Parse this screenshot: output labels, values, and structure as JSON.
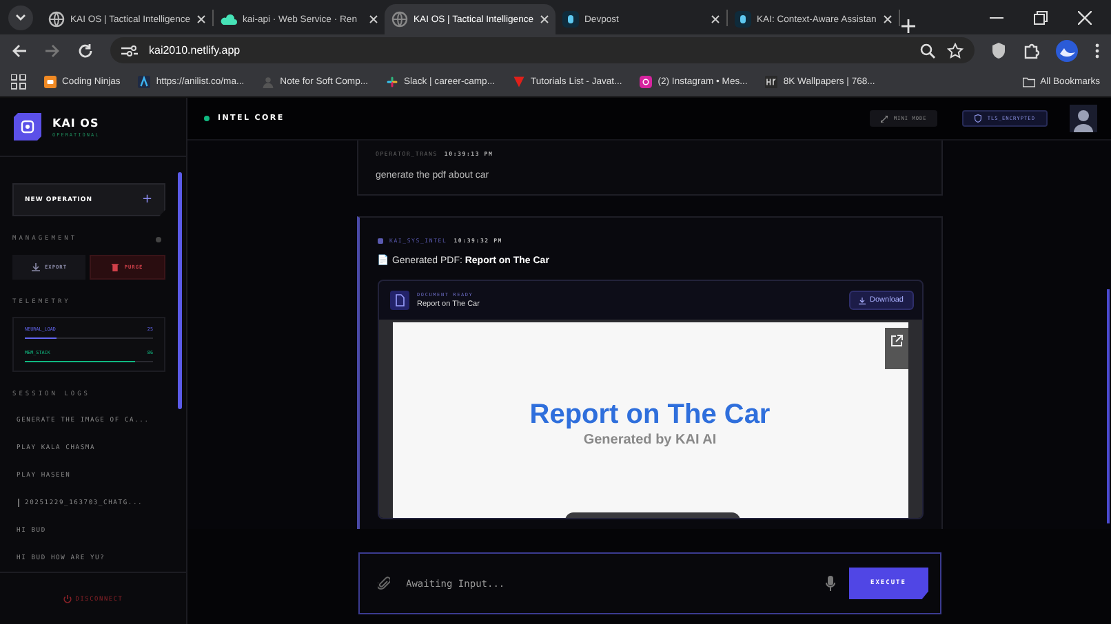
{
  "browser": {
    "tabs": [
      {
        "title": "KAI OS | Tactical Intelligence",
        "kind": "globe",
        "selected": false
      },
      {
        "title": "kai-api · Web Service · Ren",
        "kind": "cloud",
        "selected": false
      },
      {
        "title": "KAI OS | Tactical Intelligence",
        "kind": "globe",
        "selected": true
      },
      {
        "title": "Devpost",
        "kind": "letter",
        "selected": false
      },
      {
        "title": "KAI: Context-Aware Assistan",
        "kind": "letter",
        "selected": false
      }
    ],
    "address": "kai2010.netlify.app",
    "bookmarks": [
      {
        "label": "Coding Ninjas",
        "kind": "orange"
      },
      {
        "label": "https://anilist.co/ma...",
        "kind": "navy"
      },
      {
        "label": "Note for Soft Comp...",
        "kind": "person"
      },
      {
        "label": "Slack | career-camp...",
        "kind": "slack"
      },
      {
        "label": "Tutorials List - Javat...",
        "kind": "red"
      },
      {
        "label": "(2) Instagram • Mes...",
        "kind": "insta"
      },
      {
        "label": "8K Wallpapers | 768...",
        "kind": "grey"
      }
    ],
    "all_bookmarks": "All Bookmarks"
  },
  "sidebar": {
    "title": "KAI OS",
    "status": "OPERATIONAL",
    "new_operation": {
      "label": "NEW OPERATION",
      "icon": "+"
    },
    "management": {
      "heading": "MANAGEMENT",
      "buttons": [
        {
          "label": "EXPORT",
          "kind": "export"
        },
        {
          "label": "PURGE",
          "kind": "purge"
        }
      ]
    },
    "telemetry": {
      "heading": "TELEMETRY",
      "meters": [
        {
          "name": "NEURAL_LOAD",
          "reading": "25",
          "level": 0.25,
          "color": "#6366f1"
        },
        {
          "name": "MEM_STACK",
          "reading": "86",
          "level": 0.86,
          "color": "#10b981"
        }
      ]
    },
    "session_logs": {
      "heading": "SESSION LOGS",
      "items": [
        {
          "label": "GENERATE THE IMAGE OF CA...",
          "kind": "chat"
        },
        {
          "label": "PLAY KALA CHASMA",
          "kind": "chat"
        },
        {
          "label": "PLAY HASEEN",
          "kind": "chat"
        },
        {
          "label": "20251229_163703_CHATG...",
          "kind": "file"
        },
        {
          "label": "HI BUD",
          "kind": "chat"
        },
        {
          "label": "HI BUD HOW ARE YU?",
          "kind": "chat"
        }
      ]
    },
    "disconnect": "DISCONNECT"
  },
  "header": {
    "title": "INTEL CORE",
    "online": true,
    "buttons": [
      {
        "label": "MINI MODE",
        "kind": "mini"
      },
      {
        "label": "TLS_ENCRYPTED",
        "kind": "tls"
      }
    ]
  },
  "messages": [
    {
      "kind": "user",
      "sender": "OPERATOR_TRANS",
      "time": "10:39:13 PM",
      "text": "generate the pdf about car"
    },
    {
      "kind": "assistant",
      "sender": "KAI_SYS_INTEL",
      "time": "10:39:32 PM",
      "text": "📄 Generated PDF: **Report on The Car**",
      "document": {
        "status": "DOCUMENT READY",
        "name": "Report on The Car",
        "action": "Download",
        "preview_title": "Report on The Car",
        "preview_subtitle": "Generated by KAI AI"
      }
    }
  ],
  "composer": {
    "placeholder": "Awaiting Input...",
    "submit": "EXECUTE"
  }
}
